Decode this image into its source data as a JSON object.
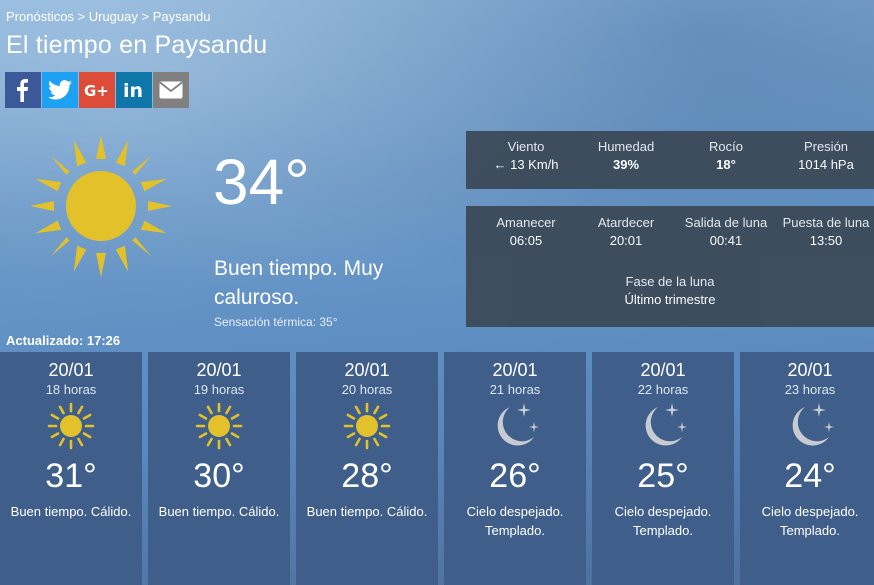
{
  "header": {
    "breadcrumb": "Pronósticos > Uruguay > Paysandu",
    "title": "El tiempo en Paysandu"
  },
  "social": [
    {
      "name": "facebook",
      "glyph": "f",
      "color": "#3b5998"
    },
    {
      "name": "twitter",
      "glyph": "twitter-bird",
      "color": "#1da1f2"
    },
    {
      "name": "google-plus",
      "glyph": "G+",
      "color": "#dd4b39"
    },
    {
      "name": "linkedin",
      "glyph": "in",
      "color": "#0e76a8"
    },
    {
      "name": "email",
      "glyph": "envelope",
      "color": "#808080"
    }
  ],
  "current": {
    "icon": "sun-icon",
    "temperature": "34°",
    "description": "Buen tiempo. Muy caluroso.",
    "feels_like": "Sensación térmica: 35°",
    "updated": "Actualizado: 17:26"
  },
  "details": {
    "wind_label": "Viento",
    "wind_value": "13 Km/h",
    "wind_arrow": "←",
    "humidity_label": "Humedad",
    "humidity_value": "39%",
    "dew_label": "Rocío",
    "dew_value": "18°",
    "pressure_label": "Presión",
    "pressure_value": "1014 hPa"
  },
  "astro": {
    "sunrise_label": "Amanecer",
    "sunrise_value": "06:05",
    "sunset_label": "Atardecer",
    "sunset_value": "20:01",
    "moonrise_label": "Salida de luna",
    "moonrise_value": "00:41",
    "moonset_label": "Puesta de luna",
    "moonset_value": "13:50",
    "moonphase_label": "Fase de la luna",
    "moonphase_value": "Último trimestre"
  },
  "forecast": [
    {
      "date": "20/01",
      "hour": "18 horas",
      "icon": "sun-icon",
      "temp": "31°",
      "desc": "Buen tiempo. Cálido."
    },
    {
      "date": "20/01",
      "hour": "19 horas",
      "icon": "sun-icon",
      "temp": "30°",
      "desc": "Buen tiempo. Cálido."
    },
    {
      "date": "20/01",
      "hour": "20 horas",
      "icon": "sun-icon",
      "temp": "28°",
      "desc": "Buen tiempo. Cálido."
    },
    {
      "date": "20/01",
      "hour": "21 horas",
      "icon": "moon-stars-icon",
      "temp": "26°",
      "desc": "Cielo despejado. Templado."
    },
    {
      "date": "20/01",
      "hour": "22 horas",
      "icon": "moon-stars-icon",
      "temp": "25°",
      "desc": "Cielo despejado. Templado."
    },
    {
      "date": "20/01",
      "hour": "23 horas",
      "icon": "moon-stars-icon",
      "temp": "24°",
      "desc": "Cielo despejado. Templado."
    }
  ],
  "colors": {
    "panel": "#3d4b5a",
    "forecast_card": "#3f5f8a",
    "sun": "#e3c12b",
    "moon": "#c8ccd2"
  }
}
